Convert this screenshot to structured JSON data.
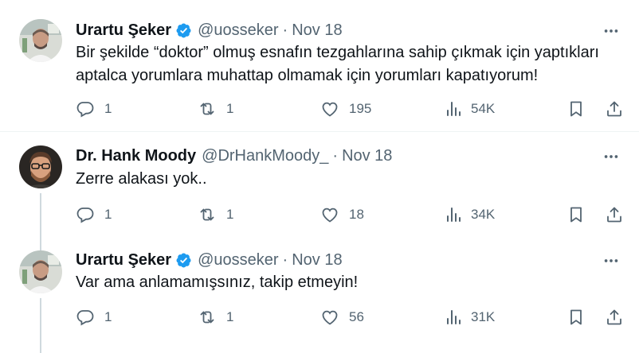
{
  "tweets": [
    {
      "name": "Urartu Şeker",
      "verified": true,
      "handle": "@uosseker",
      "separator": "·",
      "date": "Nov 18",
      "text": "Bir şekilde “doktor” olmuş esnafın tezgahlarına sahip çıkmak için yaptıkları aptalca yorumlara muhattap olmamak için yorumları kapatıyorum!",
      "replies": "1",
      "reposts": "1",
      "likes": "195",
      "views": "54K"
    },
    {
      "name": "Dr. Hank Moody",
      "verified": false,
      "handle": "@DrHankMoody_",
      "separator": "·",
      "date": "Nov 18",
      "text": "Zerre alakası yok..",
      "replies": "1",
      "reposts": "1",
      "likes": "18",
      "views": "34K"
    },
    {
      "name": "Urartu Şeker",
      "verified": true,
      "handle": "@uosseker",
      "separator": "·",
      "date": "Nov 18",
      "text": "Var ama anlamamışsınız, takip etmeyin!",
      "replies": "1",
      "reposts": "1",
      "likes": "56",
      "views": "31K"
    }
  ],
  "colors": {
    "accent": "#1d9bf0",
    "muted": "#536471",
    "text": "#0f1419",
    "divider": "#eff3f4",
    "thread_line": "#cfd9de"
  },
  "icons": [
    "more-icon",
    "verified-badge-icon",
    "reply-icon",
    "repost-icon",
    "like-icon",
    "views-icon",
    "bookmark-icon",
    "share-icon"
  ]
}
